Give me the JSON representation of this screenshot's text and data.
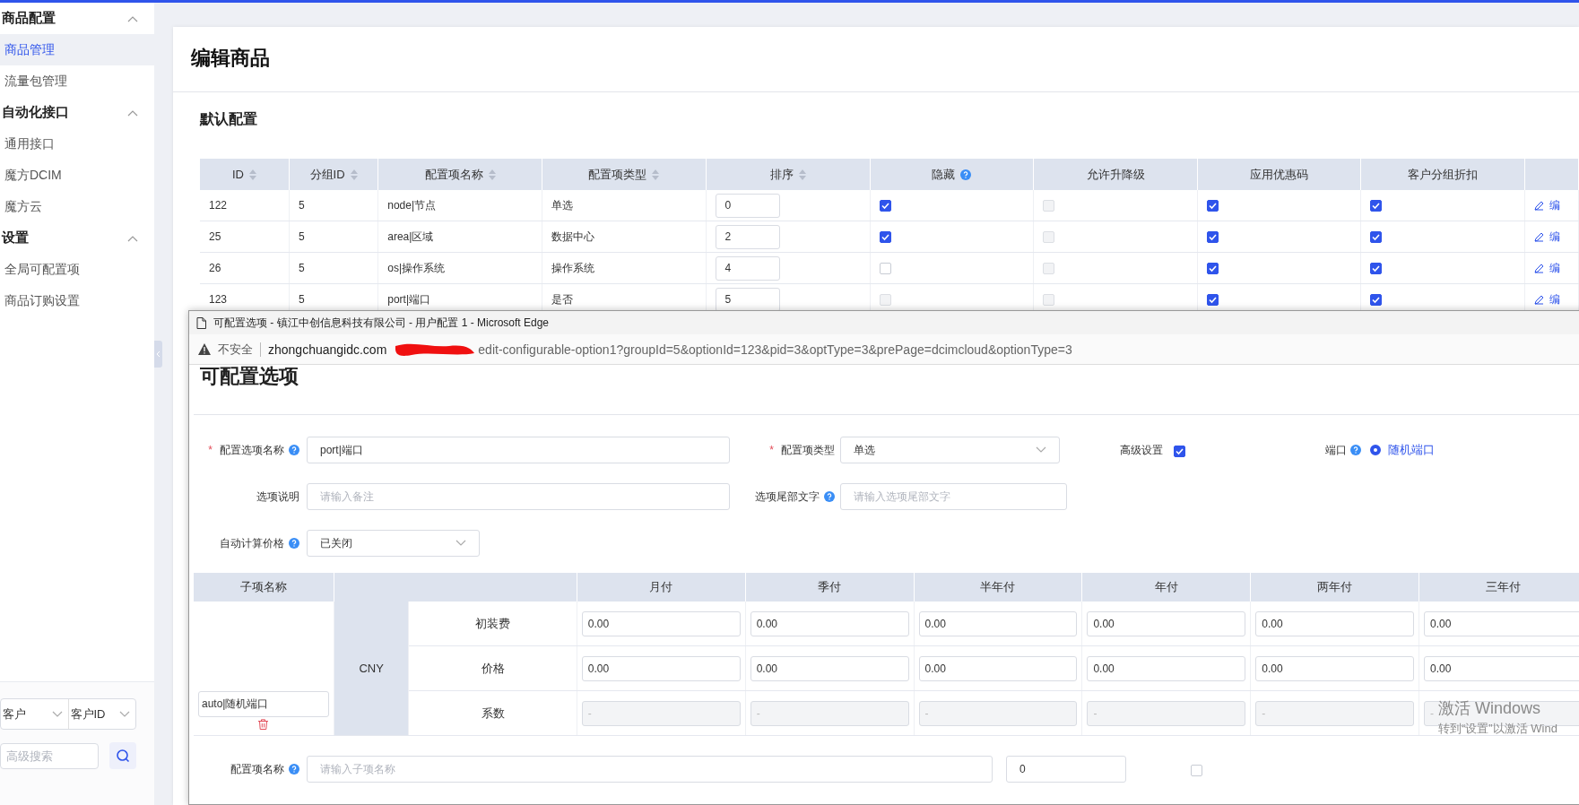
{
  "sidebar": {
    "groups": [
      {
        "label": "商品配置",
        "expanded": true,
        "items": [
          {
            "label": "商品管理",
            "selected": true
          },
          {
            "label": "流量包管理",
            "selected": false
          }
        ]
      },
      {
        "label": "自动化接口",
        "expanded": true,
        "items": [
          {
            "label": "通用接口",
            "selected": false
          },
          {
            "label": "魔方DCIM",
            "selected": false
          },
          {
            "label": "魔方云",
            "selected": false
          }
        ]
      },
      {
        "label": "设置",
        "expanded": true,
        "items": [
          {
            "label": "全局可配置项",
            "selected": false
          },
          {
            "label": "商品订购设置",
            "selected": false
          }
        ]
      }
    ],
    "filters": [
      "客户",
      "客户ID"
    ],
    "search_placeholder": "高级搜索"
  },
  "page": {
    "title": "编辑商品",
    "section": "默认配置"
  },
  "table": {
    "columns": [
      {
        "label": "ID",
        "sortable": true,
        "help": false
      },
      {
        "label": "分组ID",
        "sortable": true,
        "help": false
      },
      {
        "label": "配置项名称",
        "sortable": true,
        "help": false
      },
      {
        "label": "配置项类型",
        "sortable": true,
        "help": false
      },
      {
        "label": "排序",
        "sortable": true,
        "help": false
      },
      {
        "label": "隐藏",
        "sortable": false,
        "help": true
      },
      {
        "label": "允许升降级",
        "sortable": false,
        "help": false
      },
      {
        "label": "应用优惠码",
        "sortable": false,
        "help": false
      },
      {
        "label": "客户分组折扣",
        "sortable": false,
        "help": false
      }
    ],
    "rows": [
      {
        "id": "122",
        "group_id": "5",
        "name": "node|节点",
        "type": "单选",
        "order": "0",
        "checks": [
          {
            "checked": true,
            "disabled": false
          },
          {
            "checked": false,
            "disabled": true
          },
          {
            "checked": true,
            "disabled": false
          },
          {
            "checked": true,
            "disabled": false
          }
        ],
        "action": "编"
      },
      {
        "id": "25",
        "group_id": "5",
        "name": "area|区域",
        "type": "数据中心",
        "order": "2",
        "checks": [
          {
            "checked": true,
            "disabled": false
          },
          {
            "checked": false,
            "disabled": true
          },
          {
            "checked": true,
            "disabled": false
          },
          {
            "checked": true,
            "disabled": false
          }
        ],
        "action": "编"
      },
      {
        "id": "26",
        "group_id": "5",
        "name": "os|操作系统",
        "type": "操作系统",
        "order": "4",
        "checks": [
          {
            "checked": false,
            "disabled": false
          },
          {
            "checked": false,
            "disabled": true
          },
          {
            "checked": true,
            "disabled": false
          },
          {
            "checked": true,
            "disabled": false
          }
        ],
        "action": "编"
      },
      {
        "id": "123",
        "group_id": "5",
        "name": "port|端口",
        "type": "是否",
        "order": "5",
        "checks": [
          {
            "checked": false,
            "disabled": true
          },
          {
            "checked": false,
            "disabled": true
          },
          {
            "checked": true,
            "disabled": false
          },
          {
            "checked": true,
            "disabled": false
          }
        ],
        "action": "编"
      }
    ]
  },
  "popup": {
    "title": "可配置选项 - 镇江中创信息科技有限公司 - 用户配置 1 - Microsoft Edge",
    "security": "不安全",
    "url_host": "zhongchuangidc.com",
    "url_path": "edit-configurable-option1?groupId=5&optionId=123&pid=3&optType=3&prePage=dcimcloud&optionType=3",
    "heading": "可配置选项",
    "form": {
      "name_marker": "*",
      "name_label": "配置选项名称",
      "name_value": "port|端口",
      "type_marker": "*",
      "type_label": "配置项类型",
      "type_value": "单选",
      "advanced_label": "高级设置",
      "advanced_checked": true,
      "port_label": "端口",
      "port_option": "随机端口",
      "port_selected": true,
      "desc_label": "选项说明",
      "desc_placeholder": "请输入备注",
      "suffix_label": "选项尾部文字",
      "suffix_placeholder": "请输入选项尾部文字",
      "auto_label": "自动计算价格",
      "auto_value": "已关闭"
    },
    "price_table": {
      "name_header": "子项名称",
      "columns": [
        "月付",
        "季付",
        "半年付",
        "年付",
        "两年付",
        "三年付"
      ],
      "currency": "CNY",
      "item_name": "auto|随机端口",
      "rows": [
        {
          "label": "初装费",
          "kind": "input",
          "values": [
            "0.00",
            "0.00",
            "0.00",
            "0.00",
            "0.00",
            "0.00"
          ]
        },
        {
          "label": "价格",
          "kind": "input",
          "values": [
            "0.00",
            "0.00",
            "0.00",
            "0.00",
            "0.00",
            "0.00"
          ]
        },
        {
          "label": "系数",
          "kind": "disabled",
          "values": [
            "-",
            "-",
            "-",
            "-",
            "-",
            "-"
          ]
        }
      ]
    },
    "new_item": {
      "label": "配置项名称",
      "placeholder": "请输入子项名称",
      "order": "0",
      "checked": false
    }
  },
  "os_notice": {
    "title": "激活 Windows",
    "hint": "转到“设置”以激活 Wind"
  }
}
